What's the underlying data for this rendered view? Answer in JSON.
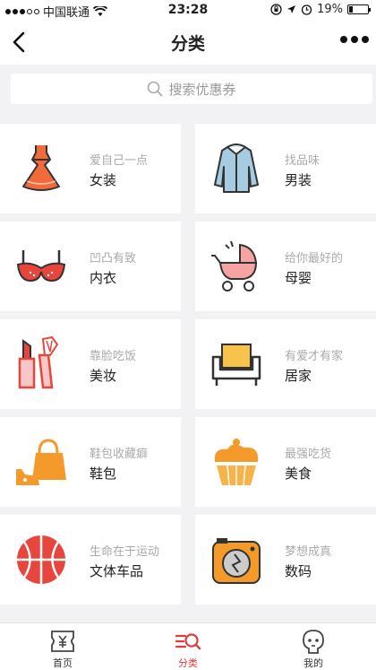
{
  "status_bar": {
    "carrier": "中国联通",
    "time": "23:28",
    "battery": "19%",
    "battery_level": 0.19
  },
  "nav": {
    "title": "分类"
  },
  "search": {
    "placeholder": "搜索优惠券"
  },
  "categories": [
    {
      "sub": "爱自己一点",
      "title": "女装",
      "icon": "dress-icon"
    },
    {
      "sub": "找品味",
      "title": "男装",
      "icon": "jacket-icon"
    },
    {
      "sub": "凹凸有致",
      "title": "内衣",
      "icon": "bra-icon"
    },
    {
      "sub": "给你最好的",
      "title": "母婴",
      "icon": "stroller-icon"
    },
    {
      "sub": "靠脸吃饭",
      "title": "美妆",
      "icon": "makeup-icon"
    },
    {
      "sub": "有爱才有家",
      "title": "居家",
      "icon": "sofa-icon"
    },
    {
      "sub": "鞋包收藏癖",
      "title": "鞋包",
      "icon": "bag-shoe-icon"
    },
    {
      "sub": "最强吃货",
      "title": "美食",
      "icon": "cupcake-icon"
    },
    {
      "sub": "生命在于运动",
      "title": "文体车品",
      "icon": "basketball-icon"
    },
    {
      "sub": "梦想成真",
      "title": "数码",
      "icon": "camera-icon"
    }
  ],
  "tabs": [
    {
      "label": "首页",
      "icon": "coupon-icon"
    },
    {
      "label": "分类",
      "icon": "category-search-icon",
      "active": true
    },
    {
      "label": "我的",
      "icon": "profile-icon"
    }
  ],
  "colors": {
    "accent": "#e03c3c",
    "orange": "#f39a2b",
    "background": "#f2f2f4"
  }
}
